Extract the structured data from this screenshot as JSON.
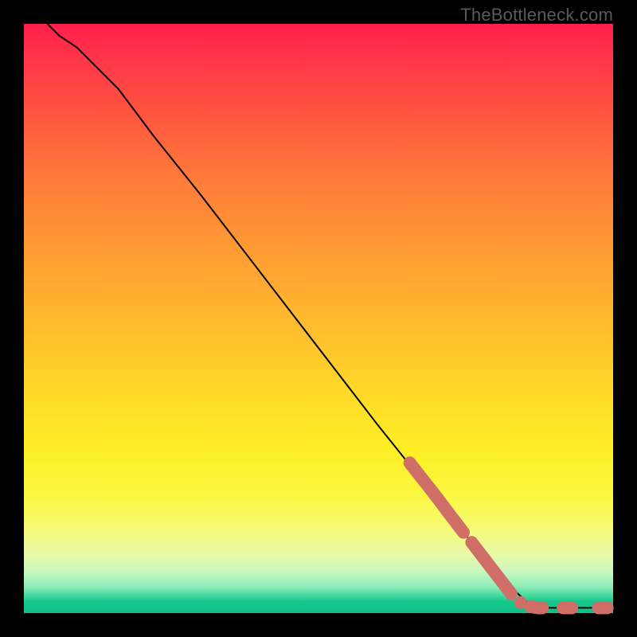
{
  "watermark": "TheBottleneck.com",
  "colors": {
    "curve_stroke": "#000000",
    "marker_fill": "#cf6f68",
    "background": "#000000"
  },
  "chart_data": {
    "type": "line",
    "title": "",
    "xlabel": "",
    "ylabel": "",
    "xlim": [
      0,
      100
    ],
    "ylim": [
      0,
      100
    ],
    "curve": [
      {
        "x": 4,
        "y": 100
      },
      {
        "x": 6,
        "y": 98
      },
      {
        "x": 9,
        "y": 96
      },
      {
        "x": 12,
        "y": 93
      },
      {
        "x": 16,
        "y": 89
      },
      {
        "x": 22,
        "y": 81
      },
      {
        "x": 30,
        "y": 71
      },
      {
        "x": 40,
        "y": 58
      },
      {
        "x": 50,
        "y": 45
      },
      {
        "x": 60,
        "y": 32
      },
      {
        "x": 68,
        "y": 22
      },
      {
        "x": 76,
        "y": 12
      },
      {
        "x": 82,
        "y": 5
      },
      {
        "x": 86,
        "y": 1.3
      },
      {
        "x": 88,
        "y": 0.9
      },
      {
        "x": 92,
        "y": 0.9
      },
      {
        "x": 96,
        "y": 0.9
      },
      {
        "x": 99,
        "y": 0.9
      }
    ],
    "marker_segments": [
      [
        {
          "x": 65.5,
          "y": 25.5
        },
        {
          "x": 66.5,
          "y": 24.2
        },
        {
          "x": 68.0,
          "y": 22.3
        },
        {
          "x": 69.5,
          "y": 20.4
        },
        {
          "x": 70.8,
          "y": 18.7
        },
        {
          "x": 72.0,
          "y": 17.1
        },
        {
          "x": 73.3,
          "y": 15.4
        },
        {
          "x": 74.6,
          "y": 13.7
        }
      ],
      [
        {
          "x": 76.0,
          "y": 12.0
        },
        {
          "x": 77.3,
          "y": 10.3
        },
        {
          "x": 78.6,
          "y": 8.6
        },
        {
          "x": 80.0,
          "y": 6.8
        },
        {
          "x": 81.3,
          "y": 5.1
        },
        {
          "x": 82.7,
          "y": 3.3
        }
      ],
      [
        {
          "x": 84.3,
          "y": 1.8
        }
      ],
      [
        {
          "x": 86.0,
          "y": 1.1
        },
        {
          "x": 87.2,
          "y": 0.9
        },
        {
          "x": 88.0,
          "y": 0.9
        }
      ],
      [
        {
          "x": 91.5,
          "y": 0.9
        },
        {
          "x": 93.0,
          "y": 0.9
        }
      ],
      [
        {
          "x": 97.5,
          "y": 0.9
        },
        {
          "x": 99.0,
          "y": 0.9
        }
      ]
    ]
  }
}
